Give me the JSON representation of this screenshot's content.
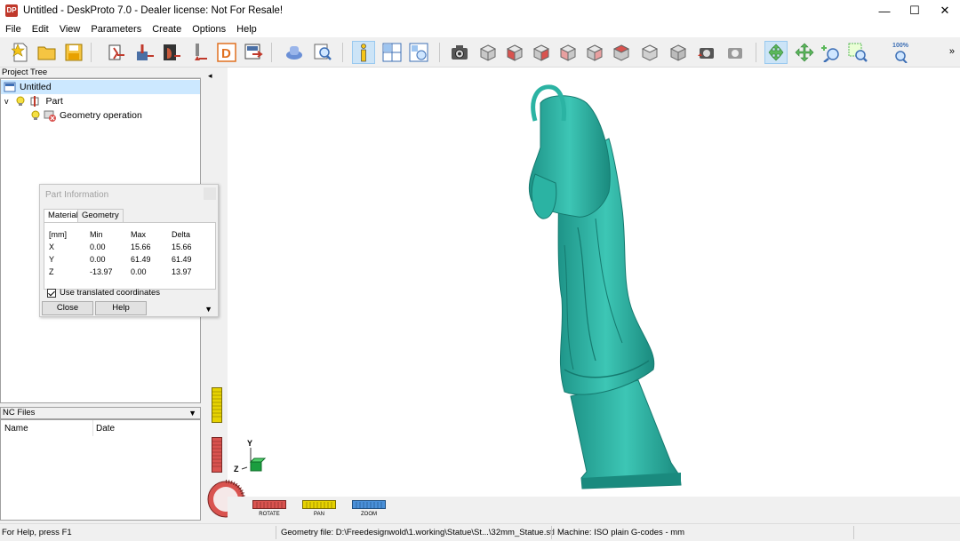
{
  "window": {
    "title": "Untitled - DeskProto 7.0 - Dealer license: Not For Resale!",
    "logo": "DP",
    "controls": [
      "—",
      "☐",
      "✕"
    ]
  },
  "menu": [
    "File",
    "Edit",
    "View",
    "Parameters",
    "Create",
    "Options",
    "Help"
  ],
  "toolbar": {
    "zoom_label": "100%",
    "more": "»",
    "colors": {
      "cube_gray": "#c8c8c8",
      "cube_red": "#d9534f",
      "accent_green": "#5cb85c"
    }
  },
  "project_tree": {
    "header": "Project Tree",
    "items": [
      {
        "label": "Untitled"
      },
      {
        "label": "Part",
        "toggle": "v"
      },
      {
        "label": "Geometry operation"
      }
    ]
  },
  "nc_files": {
    "header": "NC Files",
    "columns": [
      "Name",
      "Date"
    ]
  },
  "part_info": {
    "title": "Part Information",
    "tabs": [
      "Material",
      "Geometry"
    ],
    "header": [
      "[mm]",
      "Min",
      "Max",
      "Delta"
    ],
    "rows": [
      [
        "X",
        "0.00",
        "15.66",
        "15.66"
      ],
      [
        "Y",
        "0.00",
        "61.49",
        "61.49"
      ],
      [
        "Z",
        "-13.97",
        "0.00",
        "13.97"
      ]
    ],
    "checkbox_label": "Use translated coordinates",
    "close_label": "Close",
    "help_label": "Help"
  },
  "viewport": {
    "model_color": "#2bb3a3",
    "axis_y": "Y",
    "axis_z": "Z",
    "controls": [
      "ROTATE",
      "PAN",
      "ZOOM"
    ]
  },
  "statusbar": {
    "help": "For Help, press F1",
    "geometry": "Geometry file: D:\\Freedesignwold\\1.working\\Statue\\St...\\32mm_Statue.stl",
    "machine": "Machine: ISO plain G-codes - mm"
  }
}
